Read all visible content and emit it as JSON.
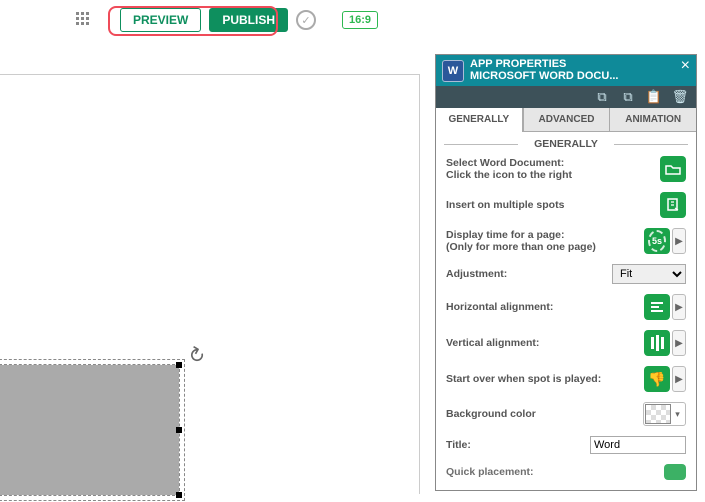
{
  "toolbar": {
    "preview_label": "PREVIEW",
    "publish_label": "PUBLISH",
    "ratio_label": "16:9"
  },
  "panel": {
    "title_line1": "APP PROPERTIES",
    "title_line2": "MICROSOFT WORD DOCU...",
    "tabs": {
      "generally": "GENERALLY",
      "advanced": "ADVANCED",
      "animation": "ANIMATION"
    },
    "section_header": "GENERALLY",
    "rows": {
      "select_doc": "Select Word Document:\nClick the icon to the right",
      "insert_multi": "Insert on multiple spots",
      "display_time": "Display time for a page:\n(Only for more than one page)",
      "display_time_val": "5s",
      "adjustment": "Adjustment:",
      "adjustment_val": "Fit",
      "h_align": "Horizontal alignment:",
      "v_align": "Vertical alignment:",
      "start_over": "Start over when spot is played:",
      "bg_color": "Background color",
      "title": "Title:",
      "title_val": "Word",
      "quick": "Quick placement:"
    }
  }
}
